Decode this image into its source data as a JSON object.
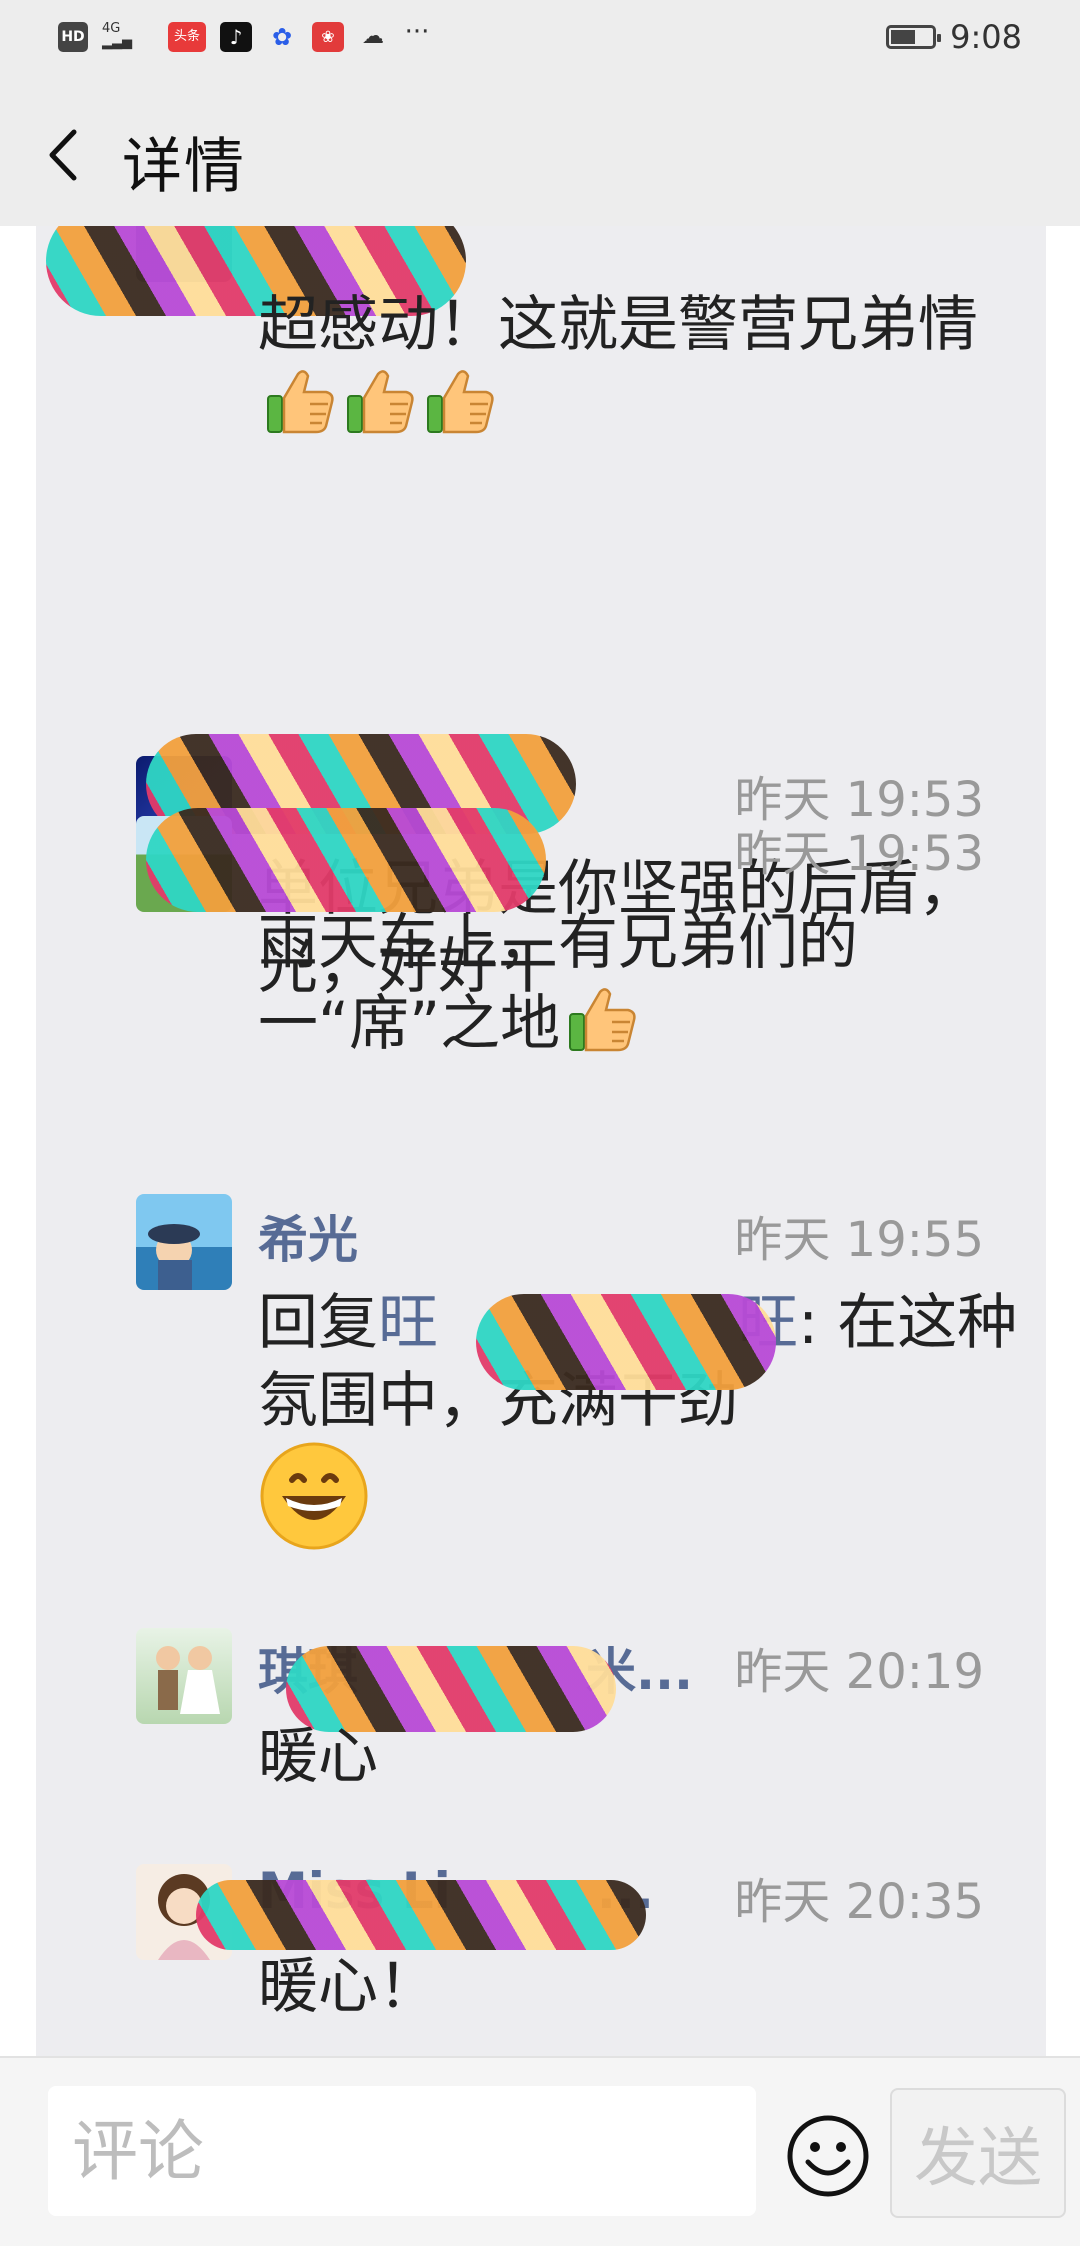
{
  "status_bar": {
    "hd_label": "HD",
    "network_label": "4G",
    "toutiao_label": "头条",
    "time": "9:08",
    "battery_level": 0.6
  },
  "header": {
    "title": "详情"
  },
  "comments": [
    {
      "text": "超感动！这就是警营兄弟情",
      "thumbs": 3
    },
    {
      "time": "昨天 19:53",
      "text": "单位兄弟是你坚强的后盾，光，好好干"
    },
    {
      "time": "昨天 19:53",
      "text": "雨天车上，有兄弟们的一“席”之地",
      "thumbs": 1
    },
    {
      "name": "希光",
      "time": "昨天 19:55",
      "reply_prefix": "回复",
      "reply_target": "旺",
      "reply_target_suffix": "旺",
      "reply_text": ": 在这种氛围中，充满干劲"
    },
    {
      "name": "琪琪",
      "name_suffix": "米...",
      "time": "昨天 20:19",
      "text": "暖心"
    },
    {
      "name": "Miss Li",
      "name_suffix": "...",
      "time": "昨天 20:35",
      "text": "暖心！"
    }
  ],
  "bottom_bar": {
    "input_placeholder": "评论",
    "send_label": "发送"
  },
  "colors": {
    "name_blue": "#576b95",
    "time_gray": "#999999",
    "card_bg": "#ededf0",
    "bar_bg": "#ededed"
  },
  "icons": [
    "back-arrow-icon",
    "thumbs-up-icon",
    "grinning-face-icon",
    "emoji-icon",
    "battery-icon"
  ]
}
